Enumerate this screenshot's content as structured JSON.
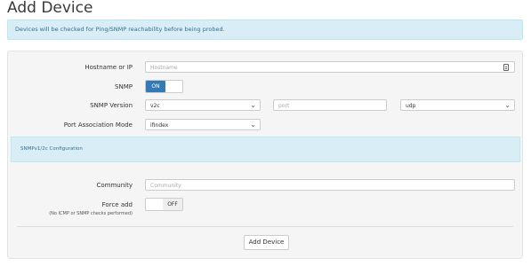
{
  "page": {
    "title": "Add Device"
  },
  "alert": {
    "text": "Devices will be checked for Ping/SNMP reachability before being probed."
  },
  "form": {
    "hostname": {
      "label": "Hostname or IP",
      "placeholder": "Hostname",
      "icon": "keyboard-icon"
    },
    "snmp": {
      "label": "SNMP",
      "state": "ON"
    },
    "snmp_version": {
      "label": "SNMP Version",
      "value": "v2c",
      "port_placeholder": "port",
      "transport": "udp"
    },
    "port_assoc": {
      "label": "Port Association Mode",
      "value": "ifIndex"
    },
    "section": {
      "title": "SNMPv1/2c Configuration"
    },
    "community": {
      "label": "Community",
      "placeholder": "Community"
    },
    "force_add": {
      "label": "Force add",
      "sublabel": "(No ICMP or SNMP checks performed)",
      "state": "OFF"
    },
    "submit": {
      "label": "Add Device"
    }
  },
  "colors": {
    "accent": "#337ab7",
    "info_bg": "#d9edf7",
    "info_text": "#31708f"
  }
}
